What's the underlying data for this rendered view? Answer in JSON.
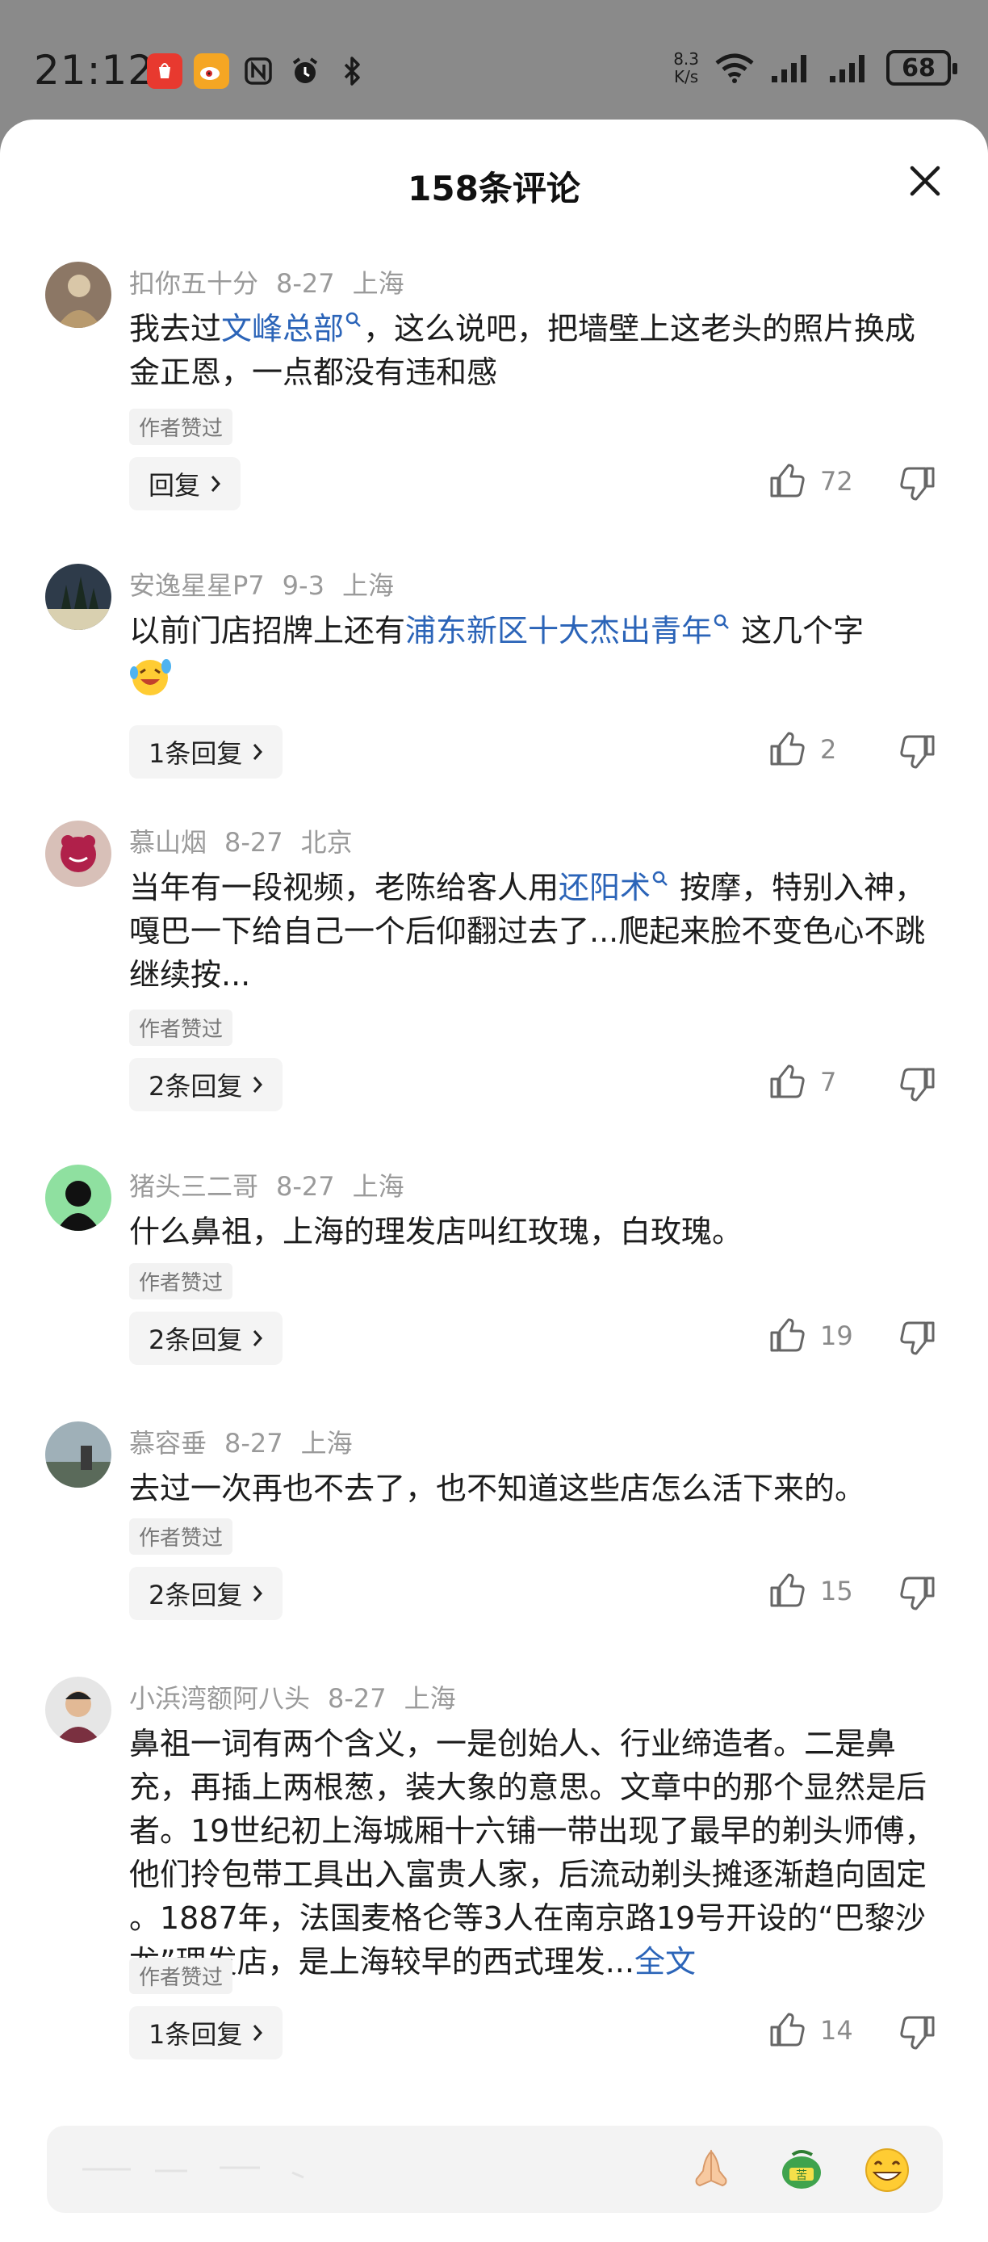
{
  "status_bar": {
    "time": "21:12",
    "speed_value": "8.3",
    "speed_unit": "K/s",
    "battery": "68"
  },
  "sheet": {
    "title": "158条评论"
  },
  "comments": [
    {
      "user": "扣你五十分",
      "date": "8-27",
      "location": "上海",
      "text_parts": [
        "我去过",
        "文峰总部",
        "，这么说吧，把墙壁上这老头的照片换成金正恩，一点都没有违和感"
      ],
      "badge": "作者赞过",
      "reply_label": "回复",
      "likes": "72"
    },
    {
      "user": "安逸星星P7",
      "date": "9-3",
      "location": "上海",
      "text_parts": [
        "以前门店招牌上还有",
        "浦东新区十大杰出青年",
        " 这几个字"
      ],
      "badge": "",
      "reply_label": "1条回复",
      "likes": "2"
    },
    {
      "user": "慕山烟",
      "date": "8-27",
      "location": "北京",
      "text_parts": [
        "当年有一段视频，老陈给客人用",
        "还阳术",
        " 按摩，特别入神，嘎巴一下给自己一个后仰翻过去了...爬起来脸不变色心不跳继续按..."
      ],
      "badge": "作者赞过",
      "reply_label": "2条回复",
      "likes": "7"
    },
    {
      "user": "猪头三二哥",
      "date": "8-27",
      "location": "上海",
      "text_parts": [
        "什么鼻祖，上海的理发店叫红玫瑰，白玫瑰。"
      ],
      "badge": "作者赞过",
      "reply_label": "2条回复",
      "likes": "19"
    },
    {
      "user": "慕容垂",
      "date": "8-27",
      "location": "上海",
      "text_parts": [
        "去过一次再也不去了，也不知道这些店怎么活下来的。"
      ],
      "badge": "作者赞过",
      "reply_label": "2条回复",
      "likes": "15"
    },
    {
      "user": "小浜湾额阿八头",
      "date": "8-27",
      "location": "上海",
      "text_parts": [
        "鼻祖一词有两个含义，一是创始人、行业缔造者。二是鼻充，再插上两根葱，装大象的意思。文章中的那个显然是后者。19世纪初上海城厢十六铺一带出现了最早的剃头师傅，他们拎包带工具出入富贵人家，后流动剃头摊逐渐趋向固定 。1887年，法国麦格仑等3人在南京路19号开设的“巴黎沙龙”理发店，是上海较早的西式理发...",
        "全文"
      ],
      "badge": "作者赞过",
      "reply_label": "1条回复",
      "likes": "14"
    }
  ],
  "colors": {
    "link": "#2b64b8",
    "meta_gray": "#9a9a9a",
    "background_dim": "#8a8a8a"
  },
  "icons": {
    "close": "close-icon",
    "like": "thumbs-up-icon",
    "dislike": "thumbs-down-icon",
    "chevron": "chevron-right-icon",
    "search_hint": "search-hint-icon"
  }
}
